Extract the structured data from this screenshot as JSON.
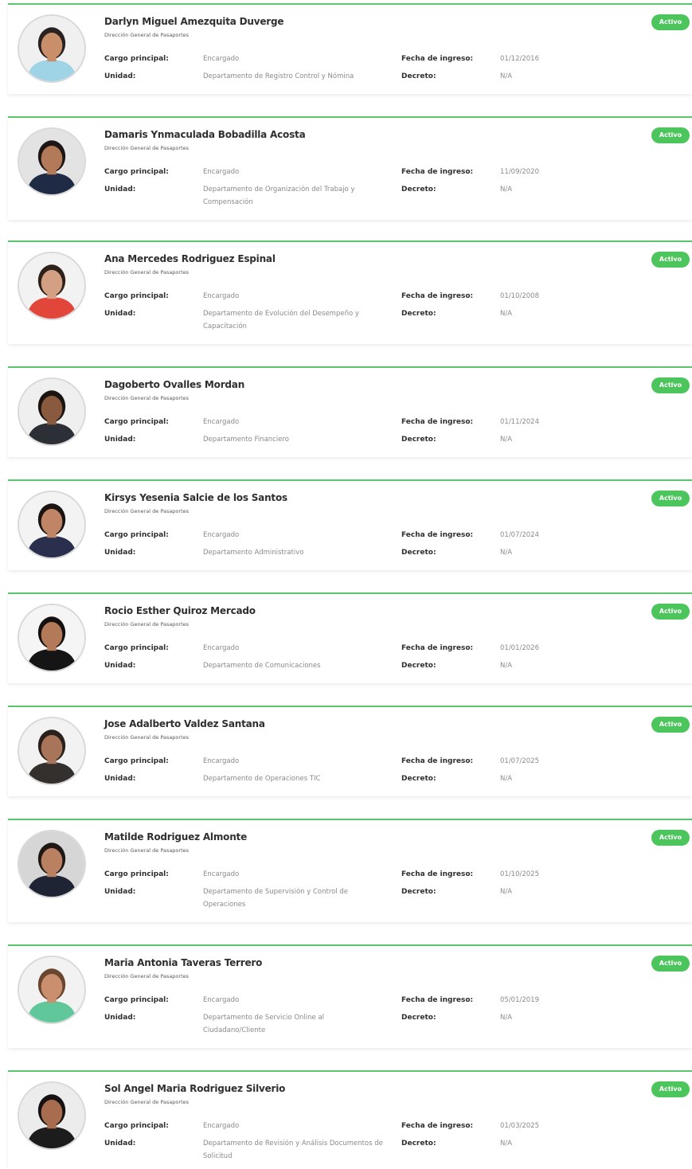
{
  "colors": {
    "accent_green": "#4cc55c",
    "card_border": "#5cc46c"
  },
  "labels": {
    "cargo": "Cargo principal:",
    "unidad": "Unidad:",
    "fecha": "Fecha de ingreso:",
    "decreto": "Decreto:"
  },
  "employees": [
    {
      "name": "Darlyn Miguel Amezquita Duverge",
      "org": "Dirección General de Pasaportes",
      "cargo": "Encargado",
      "unidad": "Departamento de Registro Control y Nómina",
      "fecha": "01/12/2016",
      "decreto": "N/A",
      "status": "Activo",
      "avatar": {
        "skin": "#c98f6a",
        "hair": "#2a2220",
        "shirt": "#9fd4e6",
        "bg": "#f0f0f0"
      }
    },
    {
      "name": "Damaris Ynmaculada Bobadilla Acosta",
      "org": "Dirección General de Pasaportes",
      "cargo": "Encargado",
      "unidad": "Departamento de Organización del Trabajo y Compensación",
      "fecha": "11/09/2020",
      "decreto": "N/A",
      "status": "Activo",
      "avatar": {
        "skin": "#b27a58",
        "hair": "#1d1614",
        "shirt": "#1f2a44",
        "bg": "#e3e3e3"
      }
    },
    {
      "name": "Ana Mercedes Rodriguez Espinal",
      "org": "Dirección General de Pasaportes",
      "cargo": "Encargado",
      "unidad": "Departamento de Evolución del Desempeño y Capacitación",
      "fecha": "01/10/2008",
      "decreto": "N/A",
      "status": "Activo",
      "avatar": {
        "skin": "#d4a084",
        "hair": "#2e211c",
        "shirt": "#e2463a",
        "bg": "#f2f2f2"
      }
    },
    {
      "name": "Dagoberto Ovalles Mordan",
      "org": "Dirección General de Pasaportes",
      "cargo": "Encargado",
      "unidad": "Departamento Financiero",
      "fecha": "01/11/2024",
      "decreto": "N/A",
      "status": "Activo",
      "avatar": {
        "skin": "#8a5a3f",
        "hair": "#1b1512",
        "shirt": "#2c2f36",
        "bg": "#efefef"
      }
    },
    {
      "name": "Kirsys Yesenia Salcie de los Santos",
      "org": "Dirección General de Pasaportes",
      "cargo": "Encargado",
      "unidad": "Departamento Administrativo",
      "fecha": "01/07/2024",
      "decreto": "N/A",
      "status": "Activo",
      "avatar": {
        "skin": "#c08566",
        "hair": "#1a1412",
        "shirt": "#2a2f4d",
        "bg": "#f3f3f3"
      }
    },
    {
      "name": "Rocio Esther Quiroz Mercado",
      "org": "Dirección General de Pasaportes",
      "cargo": "Encargado",
      "unidad": "Departamento de Comunicaciones",
      "fecha": "01/01/2026",
      "decreto": "N/A",
      "status": "Activo",
      "avatar": {
        "skin": "#b37a5a",
        "hair": "#141010",
        "shirt": "#151515",
        "bg": "#f5f5f5"
      }
    },
    {
      "name": "Jose Adalberto Valdez Santana",
      "org": "Dirección General de Pasaportes",
      "cargo": "Encargado",
      "unidad": "Departamento de Operaciones TIC",
      "fecha": "01/07/2025",
      "decreto": "N/A",
      "status": "Activo",
      "avatar": {
        "skin": "#a8745a",
        "hair": "#2b211c",
        "shirt": "#33302e",
        "bg": "#f2f2f2"
      }
    },
    {
      "name": "Matilde Rodriguez Almonte",
      "org": "Dirección General de Pasaportes",
      "cargo": "Encargado",
      "unidad": "Departamento de Supervisión y Control de Operaciones",
      "fecha": "01/10/2025",
      "decreto": "N/A",
      "status": "Activo",
      "avatar": {
        "skin": "#b98062",
        "hair": "#201815",
        "shirt": "#1e2433",
        "bg": "#d6d6d6"
      }
    },
    {
      "name": "Maria Antonia Taveras Terrero",
      "org": "Dirección General de Pasaportes",
      "cargo": "Encargado",
      "unidad": "Departamento de Servicio Online al Ciudadano/Cliente",
      "fecha": "05/01/2019",
      "decreto": "N/A",
      "status": "Activo",
      "avatar": {
        "skin": "#c98f6e",
        "hair": "#6a4630",
        "shirt": "#5fc79a",
        "bg": "#f2f2f2"
      }
    },
    {
      "name": "Sol Angel Maria Rodriguez Silverio",
      "org": "Dirección General de Pasaportes",
      "cargo": "Encargado",
      "unidad": "Departamento de Revisión y Análisis Documentos de Solicitud",
      "fecha": "01/03/2025",
      "decreto": "N/A",
      "status": "Activo",
      "avatar": {
        "skin": "#a86d4f",
        "hair": "#171212",
        "shirt": "#1c1c1c",
        "bg": "#ececec"
      }
    }
  ]
}
